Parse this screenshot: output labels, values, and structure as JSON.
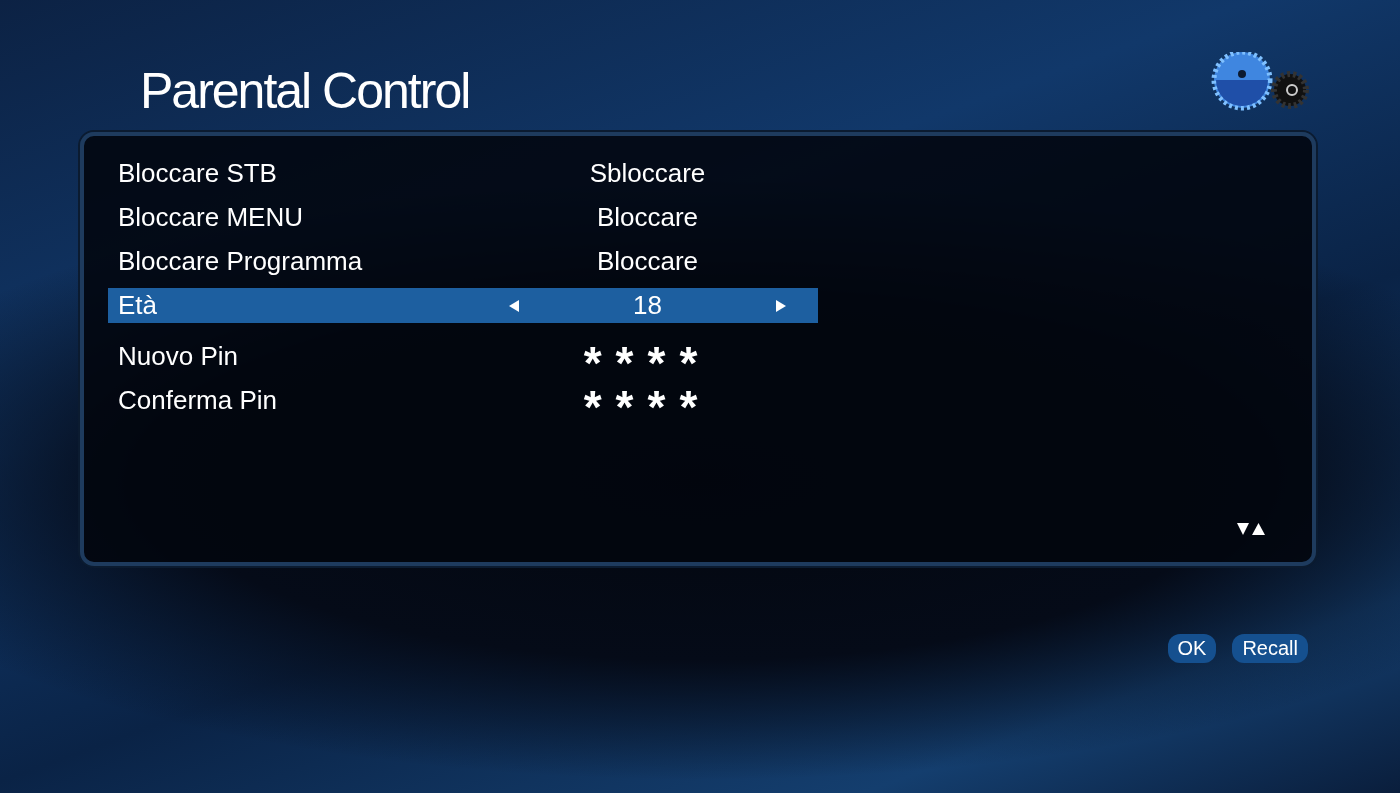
{
  "title": "Parental Control",
  "rows": [
    {
      "kind": "option",
      "label": "Bloccare STB",
      "value": "Sbloccare",
      "selected": false
    },
    {
      "kind": "option",
      "label": "Bloccare MENU",
      "value": "Bloccare",
      "selected": false
    },
    {
      "kind": "option",
      "label": "Bloccare Programma",
      "value": "Bloccare",
      "selected": false
    },
    {
      "kind": "option",
      "label": "Età",
      "value": "18",
      "selected": true
    },
    {
      "kind": "pin",
      "label": "Nuovo Pin",
      "value": "****",
      "selected": false
    },
    {
      "kind": "pin",
      "label": "Conferma Pin",
      "value": "****",
      "selected": false
    }
  ],
  "buttons": [
    "OK",
    "Recall"
  ]
}
